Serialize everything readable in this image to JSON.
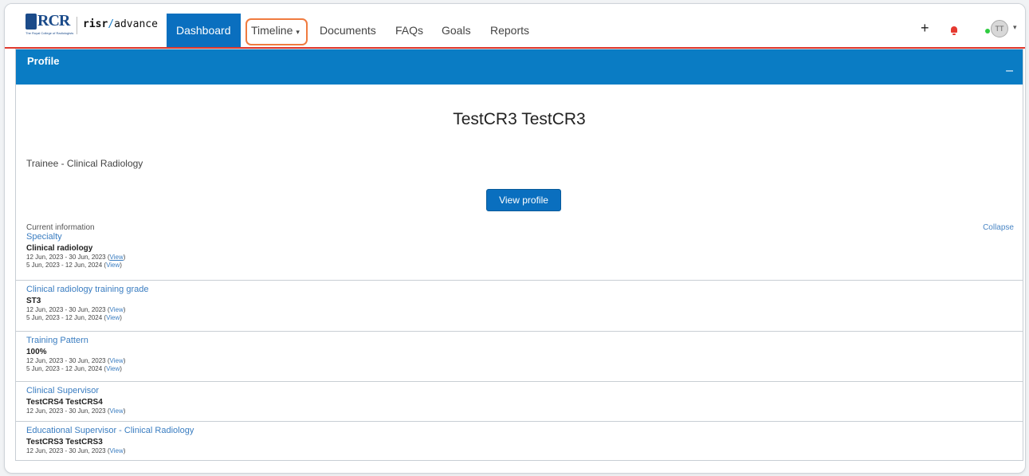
{
  "nav": {
    "brand_left": "risr",
    "brand_right": "advance",
    "logo_text": "RCR",
    "logo_sub": "The Royal College of Radiologists",
    "items": [
      {
        "label": "Dashboard"
      },
      {
        "label": "Timeline"
      },
      {
        "label": "Documents"
      },
      {
        "label": "FAQs"
      },
      {
        "label": "Goals"
      },
      {
        "label": "Reports"
      }
    ],
    "add": "+",
    "avatar_initials": "TT",
    "caret": "▾"
  },
  "panel": {
    "title": "Profile",
    "minimize": "–",
    "name": "TestCR3 TestCR3",
    "role": "Trainee - Clinical Radiology",
    "view_profile": "View profile",
    "current_label": "Current information",
    "collapse": "Collapse",
    "sections": [
      {
        "title": "Specialty",
        "value": "Clinical radiology",
        "rows": [
          {
            "dates": "12 Jun, 2023 - 30 Jun, 2023",
            "link": "View"
          },
          {
            "dates": "5 Jun, 2023 - 12 Jun, 2024",
            "link": "View"
          }
        ]
      },
      {
        "title": "Clinical radiology training grade",
        "value": "ST3",
        "rows": [
          {
            "dates": "12 Jun, 2023 - 30 Jun, 2023",
            "link": "View"
          },
          {
            "dates": "5 Jun, 2023 - 12 Jun, 2024",
            "link": "View"
          }
        ]
      },
      {
        "title": "Training Pattern",
        "value": "100%",
        "rows": [
          {
            "dates": "12 Jun, 2023 - 30 Jun, 2023",
            "link": "View"
          },
          {
            "dates": "5 Jun, 2023 - 12 Jun, 2024",
            "link": "View"
          }
        ]
      },
      {
        "title": "Clinical Supervisor",
        "value": "TestCRS4 TestCRS4",
        "rows": [
          {
            "dates": "12 Jun, 2023 - 30 Jun, 2023",
            "link": "View"
          }
        ]
      },
      {
        "title": "Educational Supervisor - Clinical Radiology",
        "value": "TestCRS3 TestCRS3",
        "rows": [
          {
            "dates": "12 Jun, 2023 - 30 Jun, 2023",
            "link": "View"
          }
        ]
      }
    ]
  }
}
